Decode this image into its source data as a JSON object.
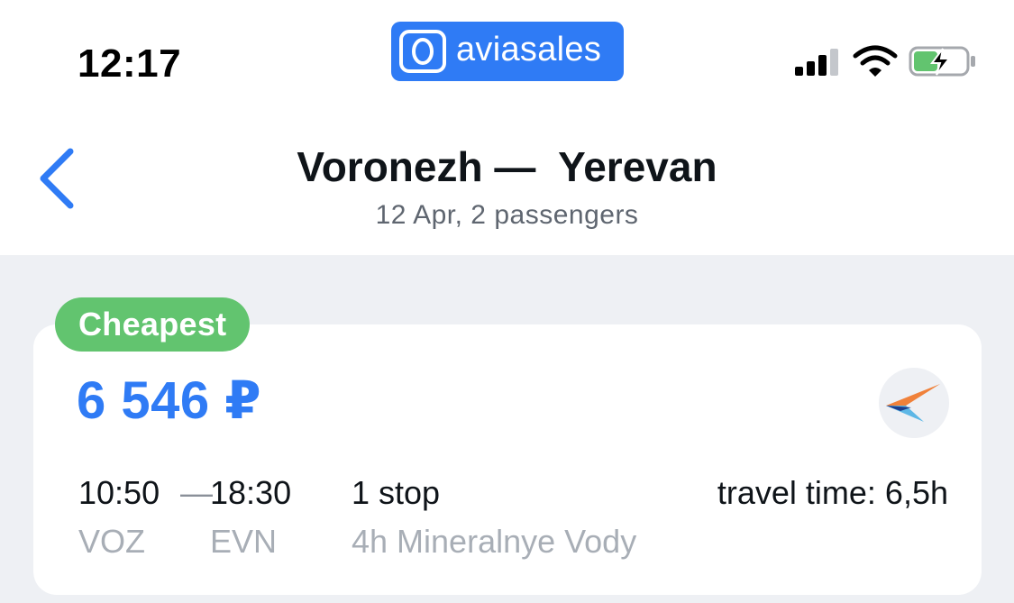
{
  "status_bar": {
    "time": "12:17",
    "brand": "aviasales",
    "icons": [
      "signal-icon",
      "wifi-icon",
      "battery-charging-icon"
    ]
  },
  "header": {
    "back_icon": "chevron-left-icon",
    "title": "Voronezh —  Yerevan",
    "subtitle": "12 Apr, 2 passengers"
  },
  "ticket": {
    "badge": "Cheapest",
    "price": "6 546 ₽",
    "departure_time": "10:50",
    "separator": "—",
    "arrival_time": "18:30",
    "departure_code": "VOZ",
    "arrival_code": "EVN",
    "stops": "1 stop",
    "stop_detail": "4h Mineralnye Vody",
    "travel_time": "travel time: 6,5h",
    "airline_icon": "airline-logo-icon"
  },
  "colors": {
    "accent": "#2f7bf5",
    "badge": "#62c46f",
    "background": "#eef0f4",
    "muted_text": "#a8aeb6"
  }
}
